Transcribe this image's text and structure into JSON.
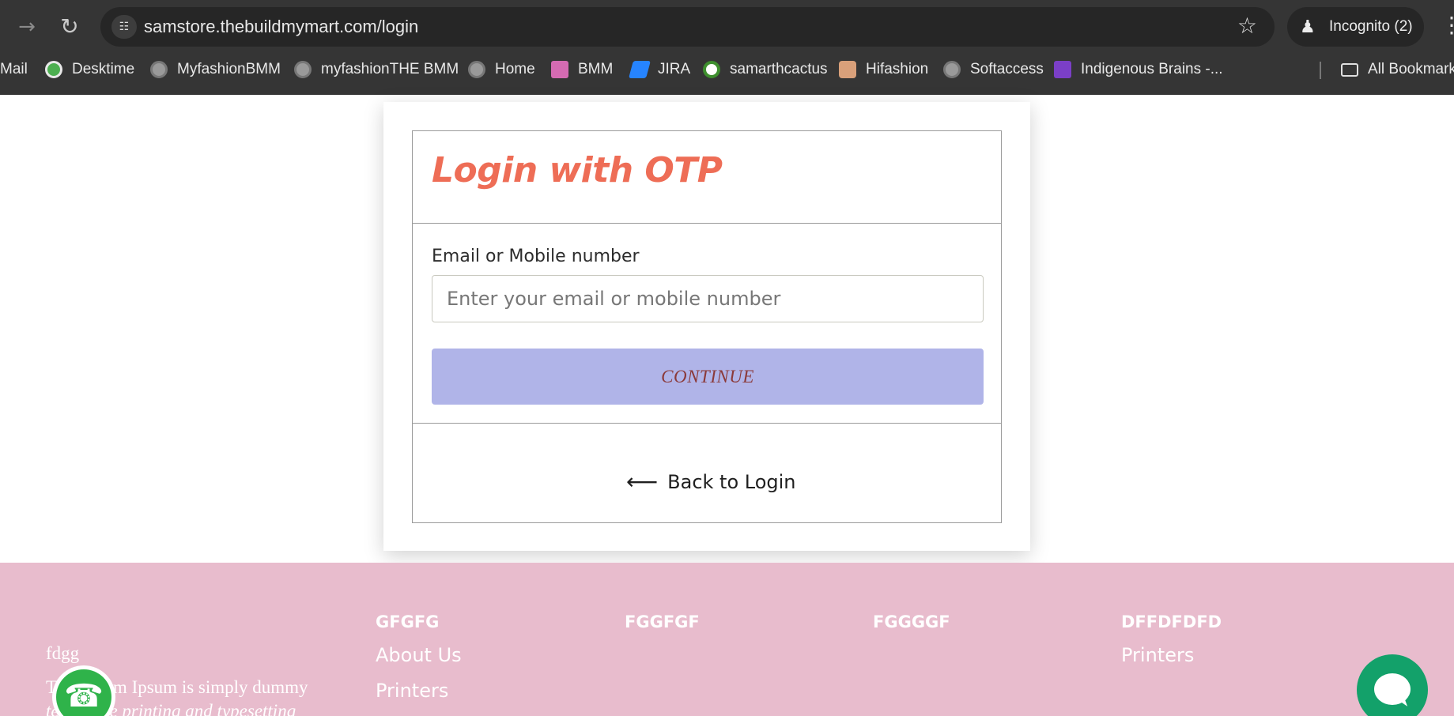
{
  "browser": {
    "url": "samstore.thebuildmymart.com/login",
    "incognito_label": "Incognito (2)",
    "forward_icon": "→",
    "reload_icon": "↻",
    "site_info_icon": "☷",
    "star_icon": "☆",
    "incognito_icon": "♟",
    "menu_icon": "⋮",
    "bookmarks": [
      {
        "label": "Mail",
        "icon": "mail-icon"
      },
      {
        "label": "Desktime",
        "icon": "desktime-icon"
      },
      {
        "label": "MyfashionBMM",
        "icon": "globe-icon"
      },
      {
        "label": "myfashionTHE BMM",
        "icon": "globe-icon"
      },
      {
        "label": "Home",
        "icon": "globe-icon"
      },
      {
        "label": "BMM",
        "icon": "bmm-icon"
      },
      {
        "label": "JIRA",
        "icon": "jira-icon"
      },
      {
        "label": "samarthcactus",
        "icon": "cactus-icon"
      },
      {
        "label": "Hifashion",
        "icon": "hifashion-icon"
      },
      {
        "label": "Softaccess",
        "icon": "globe-icon"
      },
      {
        "label": "Indigenous Brains -...",
        "icon": "indigenous-icon"
      }
    ],
    "all_bookmarks_label": "All Bookmarks"
  },
  "login": {
    "title": "Login with OTP",
    "field_label": "Email or Mobile number",
    "field_placeholder": "Enter your email or mobile number",
    "field_value": "",
    "continue_label": "CONTINUE",
    "back_arrow": "⟵",
    "back_label": "Back to Login"
  },
  "footer": {
    "brand_name": "fdgg",
    "brand_text_1": "The Lorem Ipsum is simply dummy",
    "brand_text_2": "text of the printing and typesetting",
    "columns": [
      {
        "heading": "GFGFG",
        "links": [
          "About Us",
          "Printers"
        ]
      },
      {
        "heading": "FGGFGF",
        "links": []
      },
      {
        "heading": "FGGGGF",
        "links": []
      },
      {
        "heading": "DFFDFDFD",
        "links": [
          "Printers"
        ]
      }
    ],
    "whatsapp_icon": "☎"
  },
  "colors": {
    "title": "#ee6d56",
    "continue_bg": "#b0b4e8",
    "continue_text": "#8b3a3a",
    "footer_bg": "#e8bccd",
    "whatsapp": "#2fb34a",
    "chat": "#13a16a"
  }
}
